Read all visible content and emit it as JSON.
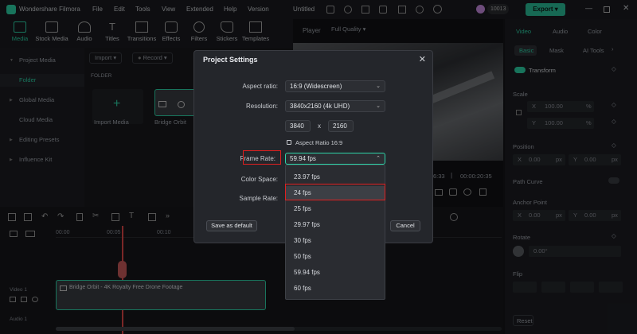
{
  "app": {
    "name": "Wondershare Filmora",
    "menu": [
      "File",
      "Edit",
      "Tools",
      "View",
      "Extended",
      "Help",
      "Version"
    ],
    "project_name": "Untitled",
    "credits": "10013",
    "export_label": "Export"
  },
  "toolbar": {
    "items": [
      "Media",
      "Stock Media",
      "Audio",
      "Titles",
      "Transitions",
      "Effects",
      "Filters",
      "Stickers",
      "Templates"
    ]
  },
  "leftnav": {
    "items": [
      "Project Media",
      "Folder",
      "Global Media",
      "Cloud Media",
      "Editing Presets",
      "Influence Kit"
    ]
  },
  "media": {
    "import_btn": "Import",
    "record_btn": "Record",
    "folder_label": "FOLDER",
    "import_tile": "Import Media",
    "clip_name": "Bridge Orbit"
  },
  "player": {
    "label": "Player",
    "quality": "Full Quality",
    "time_current": "6:33",
    "time_total": "00:00:20:35"
  },
  "rightpanel": {
    "tabs": [
      "Video",
      "Audio",
      "Color"
    ],
    "subtabs": [
      "Basic",
      "Mask",
      "AI Tools"
    ],
    "transform": "Transform",
    "scale": "Scale",
    "scale_x_label": "X",
    "scale_x": "100.00",
    "scale_y_label": "Y",
    "scale_y": "100.00",
    "percent": "%",
    "position": "Position",
    "pos_x_label": "X",
    "pos_x": "0.00",
    "pos_y_label": "Y",
    "pos_y": "0.00",
    "px": "px",
    "path_curve": "Path Curve",
    "anchor_point": "Anchor Point",
    "rotate": "Rotate",
    "rotate_value": "0.00°",
    "flip": "Flip",
    "reset": "Reset"
  },
  "timeline": {
    "ruler": [
      "00:00",
      "00:05",
      "00:10"
    ],
    "video_track": "Video 1",
    "audio_track": "Audio 1",
    "clip_label": "Bridge Orbit - 4K Royalty Free Drone Footage"
  },
  "dialog": {
    "title": "Project Settings",
    "aspect_label": "Aspect ratio:",
    "aspect_value": "16:9 (Widescreen)",
    "resolution_label": "Resolution:",
    "resolution_value": "3840x2160 (4k UHD)",
    "width": "3840",
    "times": "x",
    "height": "2160",
    "aspect_lock": "Aspect Ratio 16:9",
    "framerate_label": "Frame Rate:",
    "framerate_value": "59.94 fps",
    "colorspace_label": "Color Space:",
    "samplerate_label": "Sample Rate:",
    "save_default": "Save as default",
    "cancel": "Cancel"
  },
  "fps_options": [
    "23.97 fps",
    "24 fps",
    "25 fps",
    "29.97 fps",
    "30 fps",
    "50 fps",
    "59.94 fps",
    "60 fps"
  ],
  "fps_highlighted_index": 1,
  "colors": {
    "accent": "#2dd4a8",
    "export": "#2bbf9a",
    "highlight_box": "#e02020"
  }
}
